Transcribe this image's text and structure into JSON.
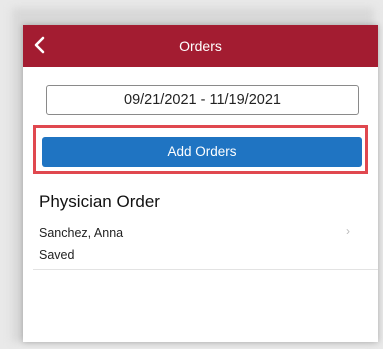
{
  "header": {
    "title": "Orders",
    "back_icon": "chevron-left-icon",
    "color": "#a31c31"
  },
  "filter": {
    "date_range": "09/21/2021 - 11/19/2021"
  },
  "actions": {
    "add_label": "Add Orders",
    "button_color": "#1f74c2",
    "highlight_color": "#e0484f"
  },
  "orders": [
    {
      "title": "Physician Order",
      "name": "Sanchez, Anna",
      "status": "Saved",
      "chevron": "›"
    }
  ]
}
